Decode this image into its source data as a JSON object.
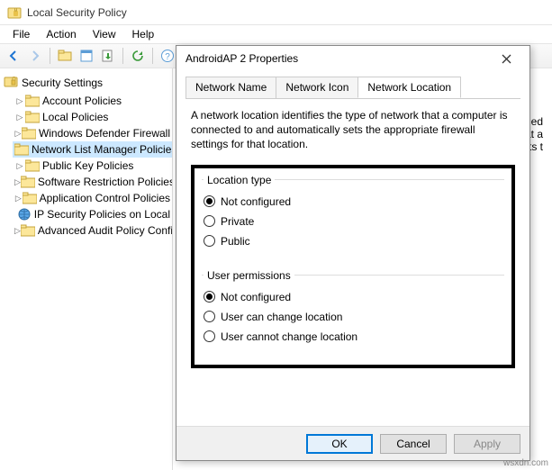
{
  "window": {
    "title": "Local Security Policy"
  },
  "menu": {
    "file": "File",
    "action": "Action",
    "view": "View",
    "help": "Help"
  },
  "tree": {
    "root": "Security Settings",
    "items": [
      {
        "label": "Account Policies"
      },
      {
        "label": "Local Policies"
      },
      {
        "label": "Windows Defender Firewall"
      },
      {
        "label": "Network List Manager Policies",
        "selected": true,
        "leaf": true
      },
      {
        "label": "Public Key Policies"
      },
      {
        "label": "Software Restriction Policies"
      },
      {
        "label": "Application Control Policies"
      },
      {
        "label": "IP Security Policies on Local",
        "special": true
      },
      {
        "label": "Advanced Audit Policy Configuration"
      }
    ]
  },
  "content": {
    "line1": "tified",
    "line2": "hat a",
    "line3": "ects t"
  },
  "dialog": {
    "title": "AndroidAP  2 Properties",
    "tabs": {
      "t1": "Network Name",
      "t2": "Network Icon",
      "t3": "Network Location"
    },
    "desc": "A network location identifies the type of network that a computer is connected to and automatically sets the appropriate firewall settings for that location.",
    "group1": {
      "legend": "Location type",
      "r1": "Not configured",
      "r2": "Private",
      "r3": "Public"
    },
    "group2": {
      "legend": "User permissions",
      "r1": "Not configured",
      "r2": "User can change location",
      "r3": "User cannot change location"
    },
    "buttons": {
      "ok": "OK",
      "cancel": "Cancel",
      "apply": "Apply"
    }
  },
  "watermark": "wsxdn.com"
}
